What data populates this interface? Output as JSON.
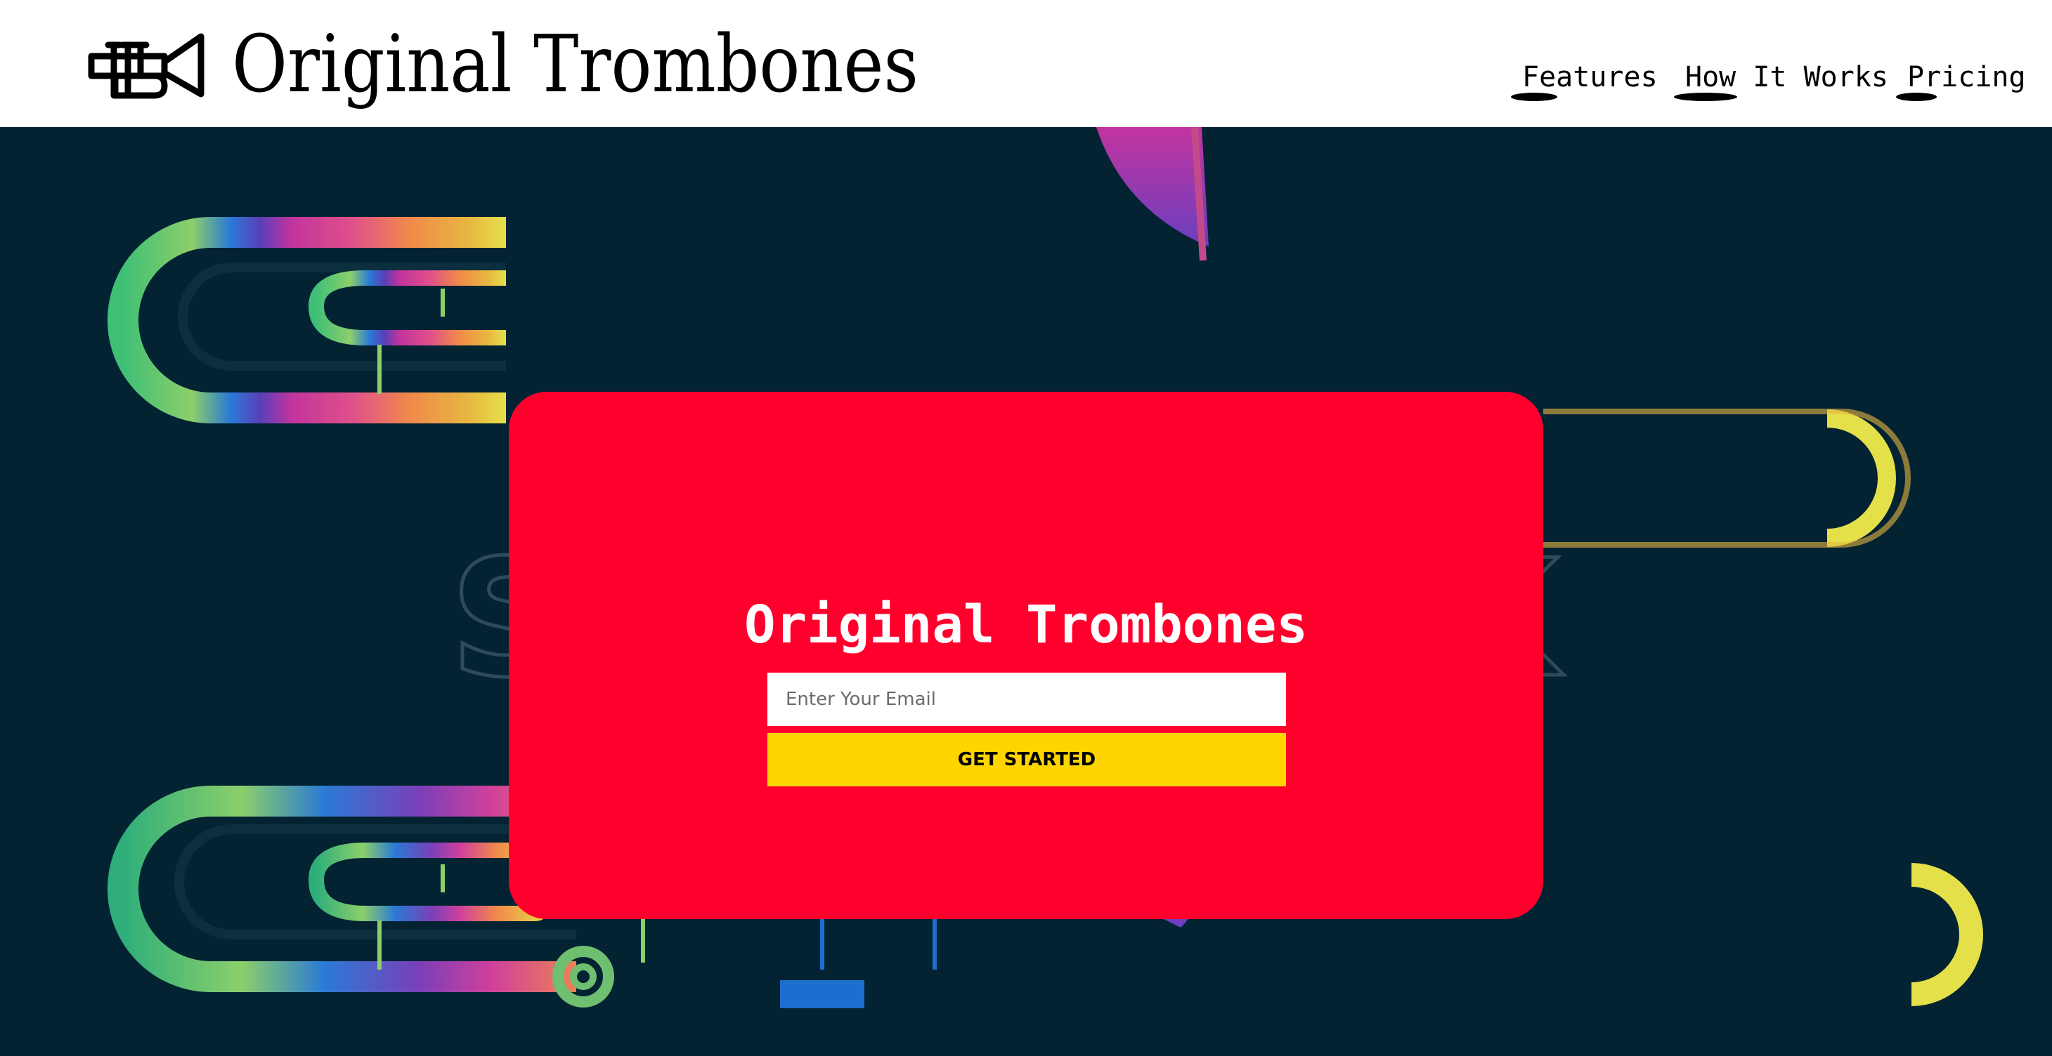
{
  "header": {
    "brand": "Original Trombones",
    "logo_icon": "trumpet-icon",
    "nav": [
      {
        "label": "Features"
      },
      {
        "label": "How It Works"
      },
      {
        "label": "Pricing"
      }
    ]
  },
  "hero": {
    "background_image": "trombone-illustration",
    "colors": {
      "background": "#032333",
      "card": "#ff002c",
      "button": "#ffd500"
    }
  },
  "signup": {
    "title": "Original Trombones",
    "email_placeholder": "Enter Your Email",
    "button_label": "GET STARTED"
  }
}
